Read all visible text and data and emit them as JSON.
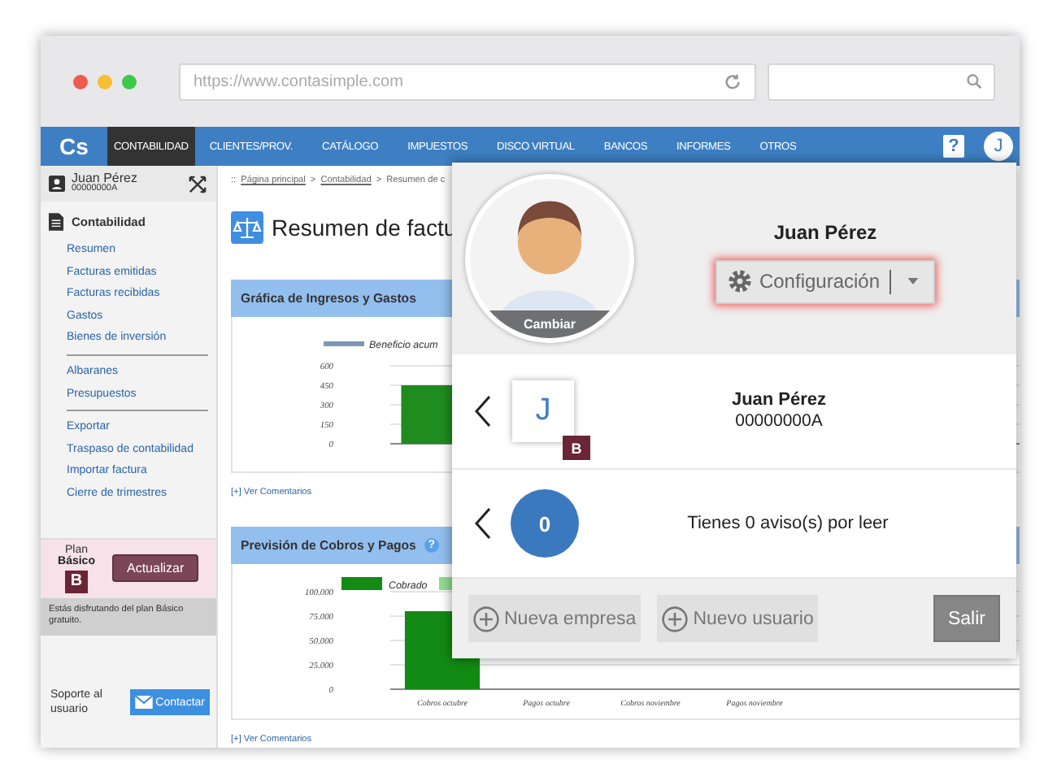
{
  "browser": {
    "url": "https://www.contasimple.com"
  },
  "nav": {
    "logo": "Cs",
    "items": [
      {
        "label": "CONTABILIDAD",
        "selected": true
      },
      {
        "label": "CLIENTES/PROV.",
        "selected": false
      },
      {
        "label": "CATÁLOGO",
        "selected": false
      },
      {
        "label": "IMPUESTOS",
        "selected": false
      },
      {
        "label": "DISCO VIRTUAL",
        "selected": false
      },
      {
        "label": "BANCOS",
        "selected": false
      },
      {
        "label": "INFORMES",
        "selected": false
      },
      {
        "label": "OTROS",
        "selected": false
      }
    ],
    "help_icon": "?",
    "avatar_letter": "J"
  },
  "sidebar": {
    "user": {
      "name": "Juan Pérez",
      "id": "00000000A"
    },
    "section": "Contabilidad",
    "groups": [
      [
        "Resumen",
        "Facturas emitidas",
        "Facturas recibidas",
        "Gastos",
        "Bienes de inversión"
      ],
      [
        "Albaranes",
        "Presupuestos"
      ],
      [
        "Exportar",
        "Traspaso de contabilidad",
        "Importar factura",
        "Cierre de trimestres"
      ]
    ],
    "plan": {
      "label": "Plan",
      "name": "Básico",
      "badge": "B",
      "button": "Actualizar"
    },
    "plan_note": "Estás disfrutando del plan Básico gratuito.",
    "support": {
      "label": "Soporte al usuario",
      "button": "Contactar"
    }
  },
  "main": {
    "breadcrumb": {
      "prefix": "::",
      "separator": ">",
      "links": [
        "Página principal",
        "Contabilidad"
      ],
      "current": "Resumen de c"
    },
    "title": "Resumen de factu",
    "panels": [
      {
        "title": "Gráfica de Ingresos y Gastos",
        "legend": [
          {
            "kind": "line",
            "label": "Beneficio acum",
            "color": "#7f97b5"
          }
        ],
        "chart_data": {
          "type": "bar",
          "grid": true,
          "ylim": [
            0,
            600
          ],
          "yticks": [
            0,
            150,
            300,
            450,
            600
          ],
          "series": [
            {
              "color": "#1e8c1e",
              "values": [
                450
              ]
            }
          ]
        },
        "comments_link": "[+] Ver Comentarios"
      },
      {
        "title": "Previsión de Cobros y Pagos",
        "help_icon": "?",
        "legend": [
          {
            "kind": "box",
            "label": "Cobrado",
            "color": "#138a13"
          },
          {
            "kind": "box",
            "color": "#8fdc8f"
          }
        ],
        "chart_data": {
          "type": "bar",
          "grid": true,
          "categories": [
            "Cobros octubre",
            "Pagos octubre",
            "Cobros noviembre",
            "Pagos noviembre"
          ],
          "ylim": [
            0,
            100000
          ],
          "yticks": [
            {
              "value": 0,
              "label": "0"
            },
            {
              "value": 25000,
              "label": "25.000"
            },
            {
              "value": 50000,
              "label": "50.000"
            },
            {
              "value": 75000,
              "label": "75.000"
            },
            {
              "value": 100000,
              "label": "100.000"
            }
          ],
          "series": [
            {
              "color": "#138a13",
              "values": [
                80000,
                null,
                null,
                null
              ]
            }
          ]
        },
        "comments_link": "[+] Ver Comentarios"
      }
    ]
  },
  "popup": {
    "avatar_label": "Cambiar",
    "name": "Juan Pérez",
    "config_button": "Configuración",
    "account": {
      "letter": "J",
      "badge": "B",
      "name": "Juan Pérez",
      "id": "00000000A"
    },
    "notices": {
      "count": "0",
      "text": "Tienes 0 aviso(s) por leer"
    },
    "buttons": [
      {
        "kind": "add",
        "label": "Nueva empresa"
      },
      {
        "kind": "add",
        "label": "Nuevo usuario"
      },
      {
        "kind": "plain",
        "label": "Salir"
      }
    ]
  }
}
